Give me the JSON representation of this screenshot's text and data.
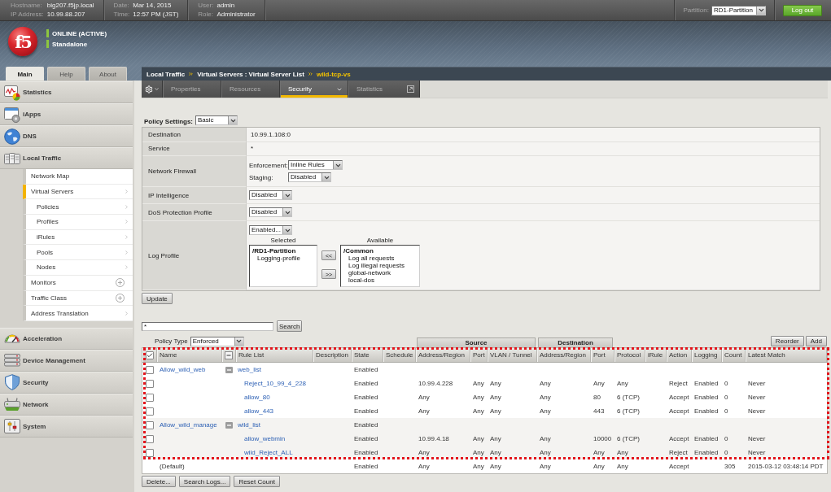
{
  "top_bar": {
    "groups": [
      {
        "fields": [
          {
            "label": "Hostname:",
            "value": "big207.f5jp.local"
          },
          {
            "label": "IP Address:",
            "value": "10.99.88.207"
          }
        ]
      },
      {
        "fields": [
          {
            "label": "Date:",
            "value": "Mar 14, 2015"
          },
          {
            "label": "Time:",
            "value": "12:57 PM (JST)"
          }
        ]
      },
      {
        "fields": [
          {
            "label": "User:",
            "value": "admin"
          },
          {
            "label": "Role:",
            "value": "Administrator"
          }
        ]
      }
    ],
    "partition": {
      "label": "Partition:",
      "value": "RD1-Partition"
    },
    "logout_button": "Log out"
  },
  "banner": {
    "logo": "f5",
    "status": [
      "ONLINE (ACTIVE)",
      "Standalone"
    ]
  },
  "sidebar": {
    "tabs": [
      {
        "label": "Main",
        "selected": true
      },
      {
        "label": "Help",
        "selected": false
      },
      {
        "label": "About",
        "selected": false
      }
    ],
    "items": [
      {
        "label": "Statistics"
      },
      {
        "label": "iApps"
      },
      {
        "label": "DNS"
      },
      {
        "label": "Local Traffic",
        "children": [
          {
            "label": "Network Map",
            "kind": "link",
            "selected": false
          },
          {
            "label": "Virtual Servers",
            "kind": "submenu",
            "selected": true,
            "children": [
              {
                "label": "Policies",
                "kind": "submenu",
                "selected": false
              },
              {
                "label": "Profiles",
                "kind": "submenu",
                "selected": false
              },
              {
                "label": "iRules",
                "kind": "submenu",
                "selected": false
              },
              {
                "label": "Pools",
                "kind": "submenu",
                "selected": false
              },
              {
                "label": "Nodes",
                "kind": "submenu",
                "selected": false
              }
            ]
          },
          {
            "label": "Monitors",
            "kind": "create",
            "selected": false
          },
          {
            "label": "Traffic Class",
            "kind": "create",
            "selected": false
          },
          {
            "label": "Address Translation",
            "kind": "submenu",
            "selected": false
          }
        ]
      },
      {
        "label": "Acceleration"
      },
      {
        "label": "Device Management"
      },
      {
        "label": "Security"
      },
      {
        "label": "Network"
      },
      {
        "label": "System"
      }
    ]
  },
  "breadcrumb": [
    {
      "label": "Local Traffic",
      "current": false
    },
    {
      "label": "Virtual Servers : Virtual Server List",
      "current": false
    },
    {
      "label": "wild-tcp-vs",
      "current": true
    }
  ],
  "tabs": [
    {
      "label": "Properties",
      "kind": "plain",
      "selected": false
    },
    {
      "label": "Resources",
      "kind": "plain",
      "selected": false
    },
    {
      "label": "Security",
      "kind": "menu",
      "selected": true
    },
    {
      "label": "Statistics",
      "kind": "popout",
      "selected": false
    }
  ],
  "policy_settings": {
    "label": "Policy Settings:",
    "value": "Basic"
  },
  "properties": [
    {
      "label": "Destination",
      "kind": "text",
      "value": "10.99.1.108:0"
    },
    {
      "label": "Service",
      "kind": "text",
      "value": "*"
    },
    {
      "label": "Network Firewall",
      "kind": "selects",
      "fields": [
        {
          "label": "Enforcement:",
          "value": "Inline Rules"
        },
        {
          "label": "Staging:",
          "value": "Disabled"
        }
      ]
    },
    {
      "label": "IP Intelligence",
      "kind": "select",
      "value": "Disabled"
    },
    {
      "label": "DoS Protection Profile",
      "kind": "select",
      "value": "Disabled"
    },
    {
      "label": "Log Profile",
      "kind": "log_profile",
      "value": "Enabled...",
      "lists": [
        {
          "title": "Selected",
          "groups": [
            {
              "name": "/RD1-Partition",
              "options": [
                "Logging-profile"
              ]
            }
          ]
        },
        {
          "title": "Available",
          "groups": [
            {
              "name": "/Common",
              "options": [
                "Log all requests",
                "Log illegal requests",
                "global-network",
                "local-dos"
              ]
            }
          ]
        }
      ],
      "move_buttons": [
        "<<",
        ">>"
      ]
    }
  ],
  "update_button": "Update",
  "search": {
    "value": "*",
    "button": "Search"
  },
  "policy_type": {
    "label": "Policy Type",
    "value": "Enforced"
  },
  "column_groups": [
    "Source",
    "Destination"
  ],
  "table_buttons": [
    "Reorder",
    "Add"
  ],
  "rules_table": {
    "select_all": {
      "checked": true
    },
    "columns": [
      "Name",
      "Rule List",
      "Description",
      "State",
      "Schedule",
      "Address/Region",
      "Port",
      "VLAN / Tunnel",
      "Address/Region",
      "Port",
      "Protocol",
      "iRule",
      "Action",
      "Logging",
      "Count",
      "Latest Match"
    ],
    "rows": [
      {
        "kind": "policy",
        "name": "Allow_wild_web",
        "rule_list": "web_list",
        "state": "Enabled",
        "checked": false,
        "expanded": true,
        "highlighted": true,
        "children": [
          {
            "kind": "rule",
            "name": "Reject_10_99_4_228",
            "state": "Enabled",
            "source_address": "10.99.4.228",
            "source_port": "Any",
            "vlan": "Any",
            "destination_address": "Any",
            "destination_port": "Any",
            "protocol": "Any",
            "action": "Reject",
            "logging": "Enabled",
            "count": "0",
            "latest_match": "Never",
            "checked": false
          },
          {
            "kind": "rule",
            "name": "allow_80",
            "state": "Enabled",
            "source_address": "Any",
            "source_port": "Any",
            "vlan": "Any",
            "destination_address": "Any",
            "destination_port": "80",
            "protocol": "6 (TCP)",
            "action": "Accept",
            "logging": "Enabled",
            "count": "0",
            "latest_match": "Never",
            "checked": false
          },
          {
            "kind": "rule",
            "name": "allow_443",
            "state": "Enabled",
            "source_address": "Any",
            "source_port": "Any",
            "vlan": "Any",
            "destination_address": "Any",
            "destination_port": "443",
            "protocol": "6 (TCP)",
            "action": "Accept",
            "logging": "Enabled",
            "count": "0",
            "latest_match": "Never",
            "checked": false
          }
        ]
      },
      {
        "kind": "policy",
        "name": "Allow_wild_manage",
        "rule_list": "wild_list",
        "state": "Enabled",
        "checked": false,
        "expanded": true,
        "highlighted": true,
        "children": [
          {
            "kind": "rule",
            "name": "allow_webmin",
            "state": "Enabled",
            "source_address": "10.99.4.18",
            "source_port": "Any",
            "vlan": "Any",
            "destination_address": "Any",
            "destination_port": "10000",
            "protocol": "6 (TCP)",
            "action": "Accept",
            "logging": "Enabled",
            "count": "0",
            "latest_match": "Never",
            "checked": false
          },
          {
            "kind": "rule",
            "name": "wild_Reject_ALL",
            "state": "Enabled",
            "source_address": "Any",
            "source_port": "Any",
            "vlan": "Any",
            "destination_address": "Any",
            "destination_port": "Any",
            "protocol": "Any",
            "action": "Reject",
            "logging": "Enabled",
            "count": "0",
            "latest_match": "Never",
            "checked": false
          }
        ]
      },
      {
        "kind": "default",
        "name": "(Default)",
        "state": "Enabled",
        "source_address": "Any",
        "source_port": "Any",
        "vlan": "Any",
        "destination_address": "Any",
        "destination_port": "Any",
        "protocol": "Any",
        "action": "Accept",
        "count": "305",
        "latest_match": "2015-03-12 03:48:14 PDT",
        "highlighted": false
      }
    ]
  },
  "bottom_buttons": [
    "Delete...",
    "Search Logs...",
    "Reset Count"
  ]
}
